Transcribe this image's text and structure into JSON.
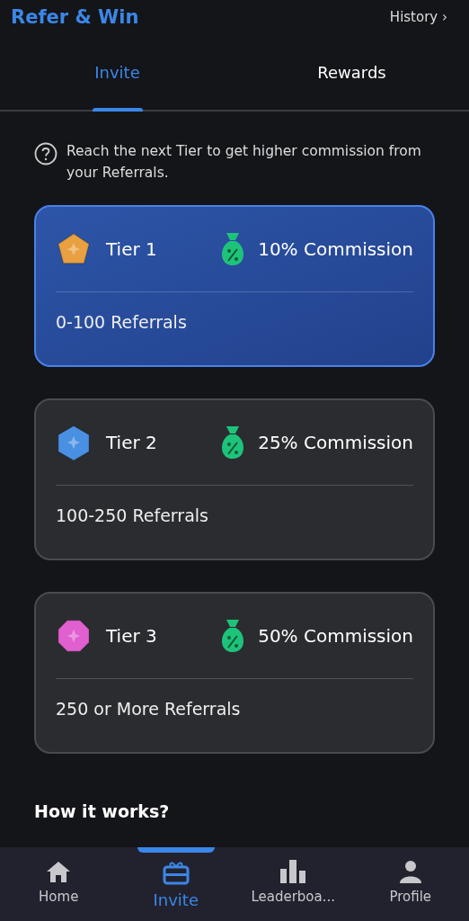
{
  "header": {
    "title": "Refer & Win",
    "history_link": "History ›"
  },
  "tabs": [
    {
      "label": "Invite",
      "selected": true
    },
    {
      "label": "Rewards",
      "selected": false
    }
  ],
  "info": "Reach the next Tier to get higher commission from your Referrals.",
  "tiers": [
    {
      "name": "Tier 1",
      "commission": "10% Commission",
      "range": "0-100 Referrals",
      "selected": true,
      "color": "#e8a040"
    },
    {
      "name": "Tier 2",
      "commission": "25% Commission",
      "range": "100-250 Referrals",
      "selected": false,
      "color": "#4a90e2"
    },
    {
      "name": "Tier 3",
      "commission": "50% Commission",
      "range": "250 or More Referrals",
      "selected": false,
      "color": "#e060d0"
    }
  ],
  "section_title": "How it works?",
  "nav": [
    {
      "kind": "home",
      "label": "Home",
      "selected": false
    },
    {
      "kind": "gift",
      "label": "Invite",
      "selected": true
    },
    {
      "kind": "chart",
      "label": "Leaderboa...",
      "selected": false
    },
    {
      "kind": "person",
      "label": "Profile",
      "selected": false
    }
  ]
}
